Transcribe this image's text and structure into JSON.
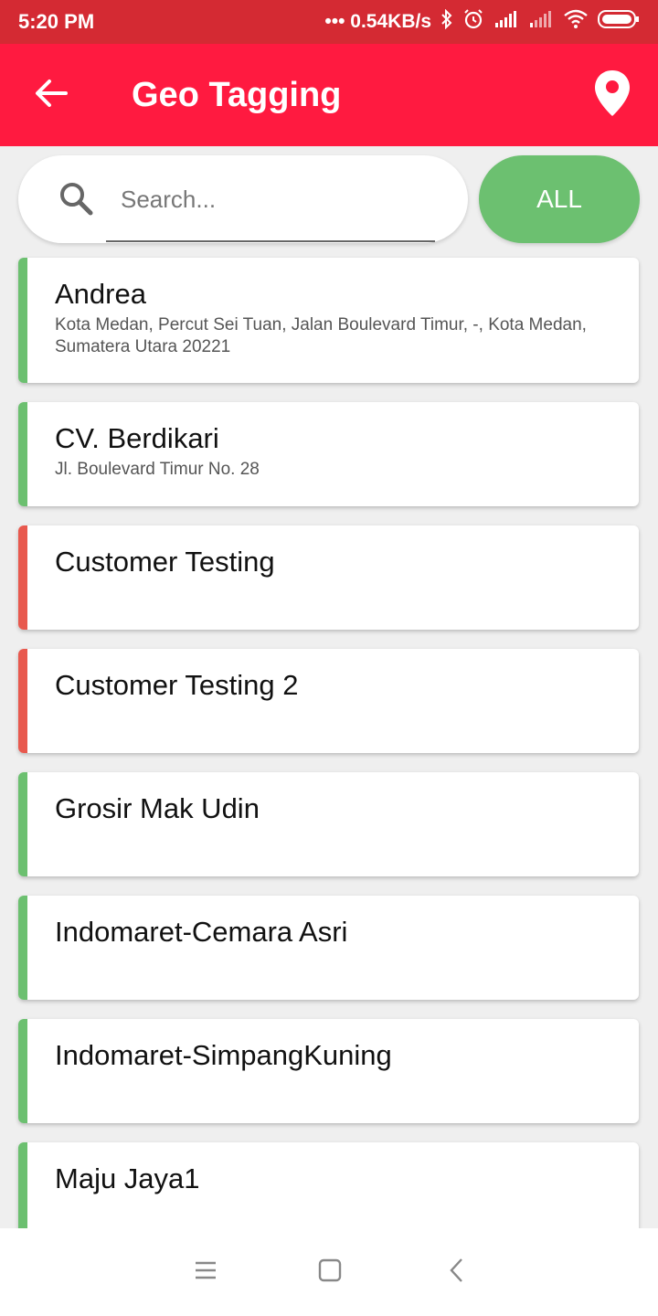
{
  "status_bar": {
    "time": "5:20 PM",
    "network_speed": "••• 0.54KB/s",
    "icons": [
      "bluetooth-icon",
      "alarm-icon",
      "signal-icon",
      "signal-icon",
      "wifi-icon",
      "battery-icon"
    ]
  },
  "app_bar": {
    "title": "Geo Tagging",
    "back_icon": "arrow-left-icon",
    "action_icon": "location-pin-icon",
    "color": "#ff1a40"
  },
  "search": {
    "placeholder": "Search...",
    "value": "",
    "filter_label": "ALL",
    "filter_color": "#6cc070"
  },
  "colors": {
    "tagged": "#6cc070",
    "untagged": "#e8594e"
  },
  "customers": [
    {
      "name": "Andrea",
      "address": "Kota Medan, Percut Sei Tuan, Jalan Boulevard Timur, -, Kota Medan, Sumatera Utara 20221",
      "status": "tagged"
    },
    {
      "name": "CV. Berdikari",
      "address": "Jl. Boulevard Timur No. 28",
      "status": "tagged"
    },
    {
      "name": "Customer Testing",
      "address": "",
      "status": "untagged"
    },
    {
      "name": "Customer Testing 2",
      "address": "",
      "status": "untagged"
    },
    {
      "name": "Grosir Mak Udin",
      "address": "",
      "status": "tagged"
    },
    {
      "name": "Indomaret-Cemara Asri",
      "address": "",
      "status": "tagged"
    },
    {
      "name": "Indomaret-SimpangKuning",
      "address": "",
      "status": "tagged"
    },
    {
      "name": "Maju Jaya1",
      "address": "",
      "status": "tagged"
    }
  ],
  "nav_bar": {
    "icons": [
      "menu-icon",
      "home-square-icon",
      "back-chevron-icon"
    ]
  }
}
